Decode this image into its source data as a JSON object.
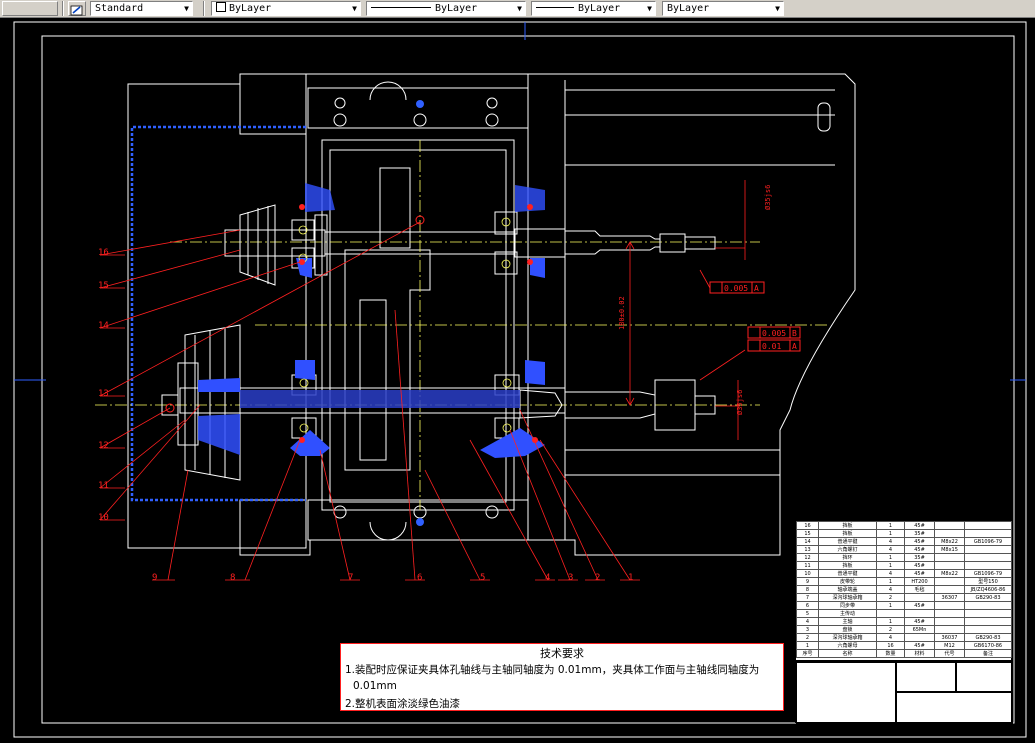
{
  "toolbar": {
    "style_value": "Standard",
    "color_value": "ByLayer",
    "linetype_value": "ByLayer",
    "lineweight_value": "ByLayer",
    "plotstyle_value": "ByLayer"
  },
  "drawing": {
    "part_numbers": [
      "16",
      "15",
      "14",
      "13",
      "12",
      "11",
      "10",
      "9",
      "8",
      "7",
      "6",
      "5",
      "4",
      "3",
      "2",
      "1"
    ],
    "dimensions": {
      "upper_shaft_dia": "Ø35js6",
      "tolerance_frame_1": "0.005",
      "datum_1": "A",
      "tolerance_frame_2": "0.005",
      "datum_2": "B",
      "tolerance_frame_3": "0.01",
      "datum_3": "A",
      "center_distance": "180±0.02",
      "lower_shaft_dia": "Ø35js6"
    }
  },
  "tech_requirements": {
    "title": "技术要求",
    "line1": "1.装配时应保证夹具体孔轴线与主轴同轴度为 0.01mm，夹具体工作面与主轴线同轴度为",
    "line1b": "0.01mm",
    "line2": "2.整机表面涂淡绿色油漆"
  },
  "bom": {
    "rows": [
      [
        "16",
        "挡板",
        "1",
        "45#",
        "",
        ""
      ],
      [
        "15",
        "挡板",
        "1",
        "35#",
        "",
        ""
      ],
      [
        "14",
        "普通平键",
        "4",
        "45#",
        "M8x22",
        "GB1096-79"
      ],
      [
        "13",
        "六角螺钉",
        "4",
        "45#",
        "M8x15",
        ""
      ],
      [
        "12",
        "挡环",
        "1",
        "35#",
        "",
        ""
      ],
      [
        "11",
        "挡板",
        "1",
        "45#",
        "",
        ""
      ],
      [
        "10",
        "普通平键",
        "4",
        "45#",
        "M8x22",
        "GB1096-79"
      ],
      [
        "9",
        "皮带轮",
        "1",
        "HT200",
        "",
        "型号150"
      ],
      [
        "8",
        "轴承端盖",
        "4",
        "毛毡",
        "",
        "JB/ZQ4606-86"
      ],
      [
        "7",
        "深沟球轴承箱",
        "2",
        "",
        "36307",
        "GB290-83"
      ],
      [
        "6",
        "同步带",
        "1",
        "45#",
        "",
        ""
      ],
      [
        "5",
        "主传动",
        "",
        "",
        "",
        ""
      ],
      [
        "4",
        "主轴",
        "1",
        "45#",
        "",
        ""
      ],
      [
        "3",
        "盘锁",
        "2",
        "65Mn",
        "",
        ""
      ],
      [
        "2",
        "深沟球轴承箱",
        "4",
        "",
        "36037",
        "GB290-83"
      ],
      [
        "1",
        "六角螺母",
        "16",
        "45#",
        "M12",
        "GB6170-86"
      ],
      [
        "序号",
        "名称",
        "数量",
        "材料",
        "代号",
        "备注"
      ]
    ]
  },
  "colors": {
    "background": "#000000",
    "outline": "#ffffff",
    "leader": "#ff2020",
    "hatch": "#3050ff",
    "center": "#ffff60",
    "dimension": "#ff2020"
  }
}
